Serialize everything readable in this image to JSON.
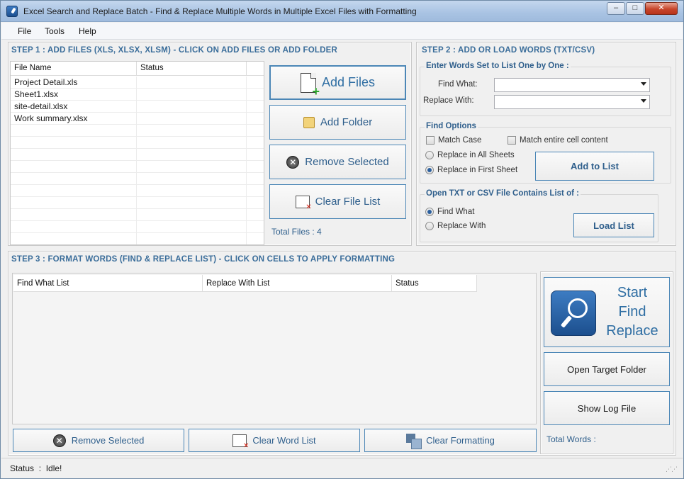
{
  "window": {
    "title": "Excel Search and Replace Batch - Find & Replace Multiple Words in Multiple Excel Files with Formatting",
    "min": "–",
    "max": "□",
    "close": "✕"
  },
  "menu": [
    "File",
    "Tools",
    "Help"
  ],
  "step1": {
    "header": "STEP 1 : ADD FILES (XLS, XLSX, XLSM) - CLICK ON ADD FILES OR ADD FOLDER",
    "columns": [
      "File Name",
      "Status"
    ],
    "files": [
      {
        "name": "Project Detail.xls",
        "status": ""
      },
      {
        "name": "Sheet1.xlsx",
        "status": ""
      },
      {
        "name": "site-detail.xlsx",
        "status": ""
      },
      {
        "name": "Work summary.xlsx",
        "status": ""
      }
    ],
    "add_files": "Add Files",
    "add_folder": "Add Folder",
    "remove_selected": "Remove Selected",
    "clear_file_list": "Clear File List",
    "total_files": "Total Files : 4"
  },
  "step2": {
    "header": "STEP 2 : ADD OR LOAD WORDS (TXT/CSV)",
    "words_group": "Enter Words Set to List One by One :",
    "find_what_label": "Find What:",
    "replace_with_label": "Replace With:",
    "find_what_value": "",
    "replace_with_value": "",
    "find_options": "Find Options",
    "match_case": "Match Case",
    "match_entire": "Match entire cell content",
    "replace_all_sheets": "Replace in All Sheets",
    "replace_first_sheet": "Replace in First Sheet",
    "add_to_list": "Add to List",
    "load_group": "Open TXT or CSV File Contains List of :",
    "load_find_what": "Find What",
    "load_replace_with": "Replace With",
    "load_list": "Load List"
  },
  "step3": {
    "header": "STEP 3 : FORMAT WORDS (FIND & REPLACE LIST) - CLICK ON CELLS TO APPLY FORMATTING",
    "columns": [
      "Find What List",
      "Replace With List",
      "Status"
    ],
    "remove_selected": "Remove Selected",
    "clear_word_list": "Clear Word List",
    "clear_formatting": "Clear Formatting",
    "start_line1": "Start",
    "start_line2": "Find",
    "start_line3": "Replace",
    "open_target_folder": "Open Target Folder",
    "show_log_file": "Show Log File",
    "total_words": "Total Words :"
  },
  "status": {
    "text": "Status  :  Idle!"
  }
}
